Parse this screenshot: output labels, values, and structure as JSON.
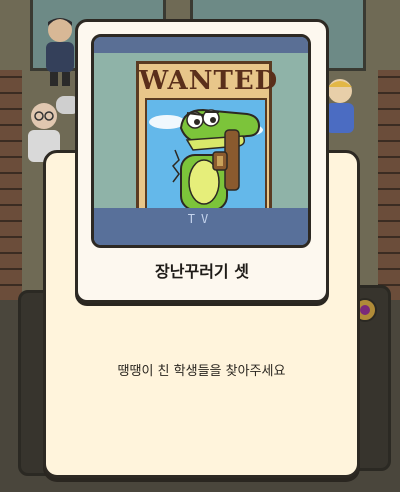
{
  "modal": {
    "character_name": "장난꾸러기 셋",
    "description": "땡땡이 친 학생들을 찾아주세요",
    "poster_title": "WANTED",
    "tv_label": "TV"
  }
}
